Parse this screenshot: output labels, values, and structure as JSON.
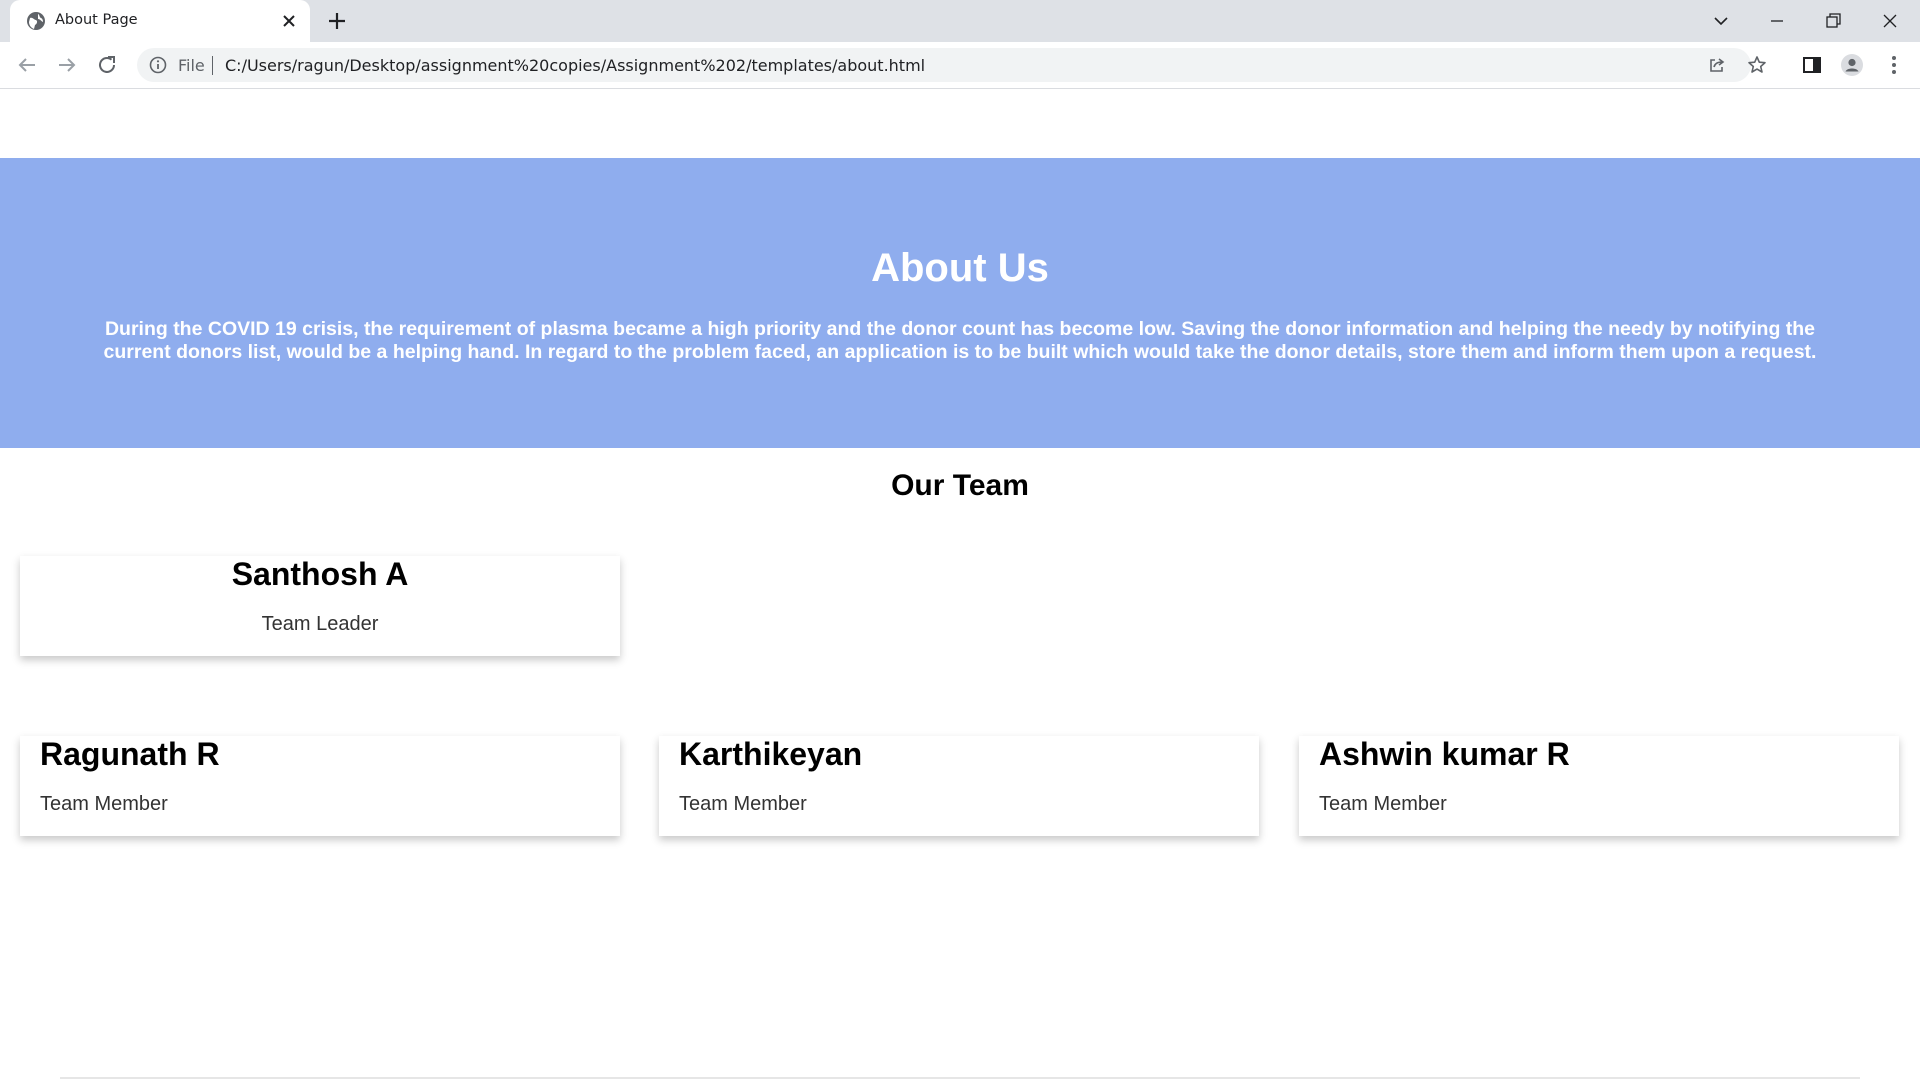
{
  "browser": {
    "tab_title": "About Page",
    "url_scheme": "File",
    "url": "C:/Users/ragun/Desktop/assignment%20copies/Assignment%202/templates/about.html"
  },
  "hero": {
    "title": "About Us",
    "description": "During the COVID 19 crisis, the requirement of plasma became a high priority and the donor count has become low. Saving the donor information and helping the needy by notifying the current donors list, would be a helping hand. In regard to the problem faced, an application is to be built which would take the donor details, store them and inform them upon a request.",
    "background_color": "#8fadee"
  },
  "team": {
    "title": "Our Team",
    "members": [
      {
        "name": "Santhosh A",
        "role": "Team Leader"
      },
      {
        "name": "Ragunath R",
        "role": "Team Member"
      },
      {
        "name": "Karthikeyan",
        "role": "Team Member"
      },
      {
        "name": "Ashwin kumar R",
        "role": "Team Member"
      }
    ]
  },
  "icons": [
    "globe-icon",
    "close-icon",
    "plus-icon",
    "chevron-down-icon",
    "minimize-icon",
    "restore-icon",
    "window-close-icon",
    "back-icon",
    "forward-icon",
    "reload-icon",
    "info-icon",
    "share-icon",
    "star-icon",
    "side-panel-icon",
    "profile-icon",
    "menu-icon"
  ]
}
